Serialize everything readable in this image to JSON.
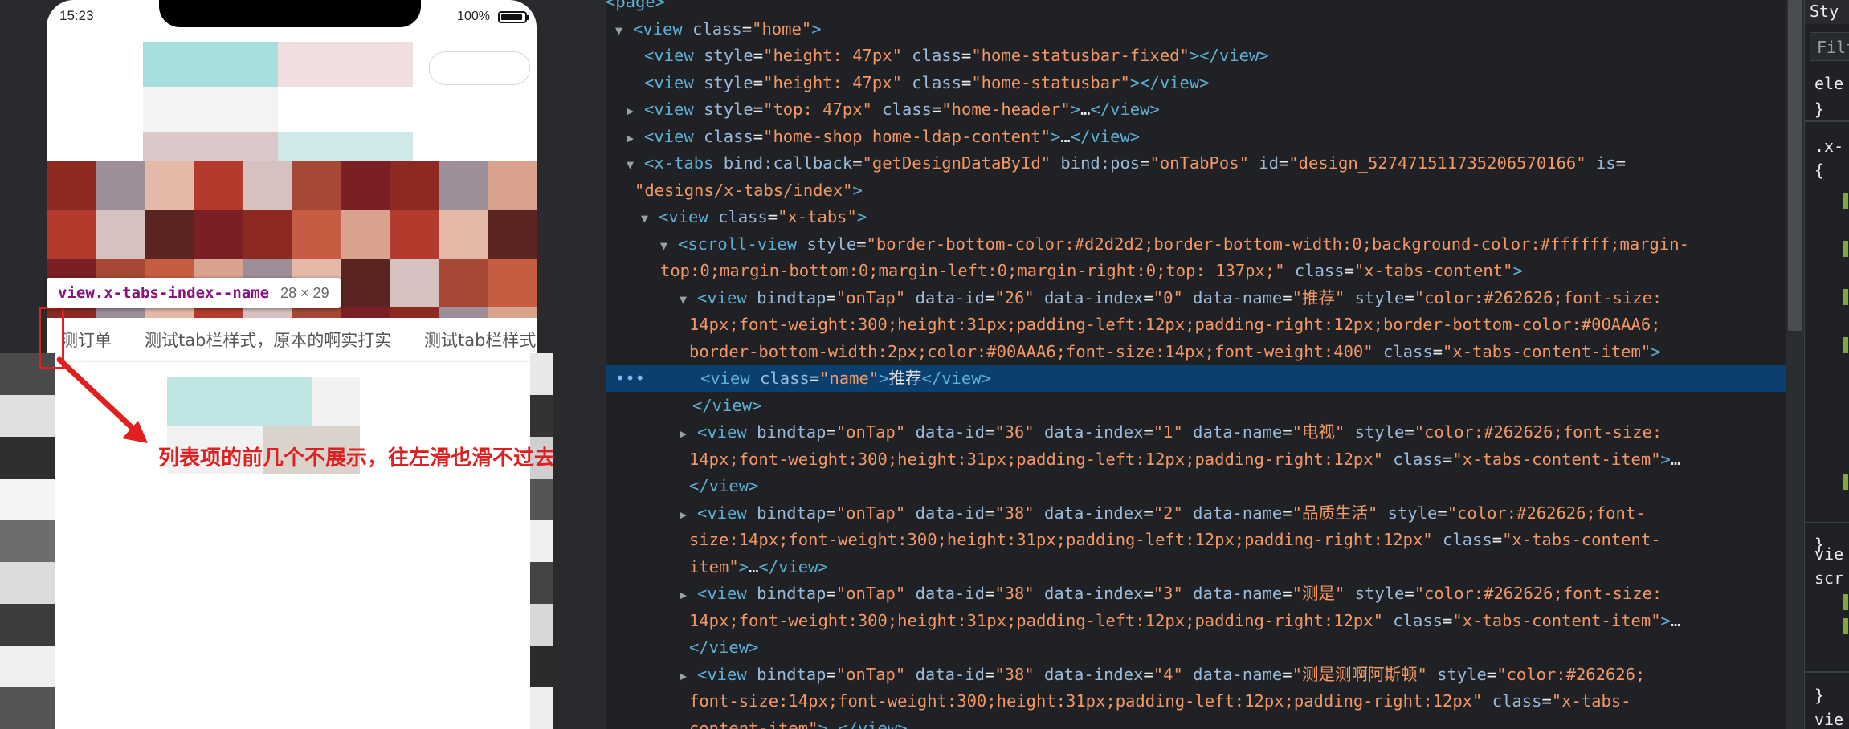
{
  "phone": {
    "status_time": "15:23",
    "battery_percent": "100%",
    "battery_icon": "battery-full-icon"
  },
  "inspector_tooltip": {
    "selector": "view.x-tabs-index--name",
    "size": "28 × 29"
  },
  "tabs": [
    "测订单",
    "测试tab栏样式，原本的啊实打实",
    "测试tab栏样式"
  ],
  "annotation": {
    "text": "列表项的前几个不展示，往左滑也滑不过去",
    "color": "#e02020"
  },
  "devtools": {
    "lines": [
      {
        "html": "<span class='tag'>&lt;page&gt;</span>"
      },
      {
        "tri": "▼",
        "html": "<span class='tag'>&lt;view</span> <span class='attr'>class</span>=<span class='val'>\"home\"</span><span class='tag'>&gt;</span>"
      },
      {
        "html": "<span class='tag'>&lt;view</span> <span class='attr'>style</span>=<span class='val'>\"height: 47px\"</span> <span class='attr'>class</span>=<span class='val'>\"home-statusbar-fixed\"</span><span class='tag'>&gt;&lt;/view&gt;</span>"
      },
      {
        "html": "<span class='tag'>&lt;view</span> <span class='attr'>style</span>=<span class='val'>\"height: 47px\"</span> <span class='attr'>class</span>=<span class='val'>\"home-statusbar\"</span><span class='tag'>&gt;&lt;/view&gt;</span>"
      },
      {
        "tri": "▶",
        "html": "<span class='tag'>&lt;view</span> <span class='attr'>style</span>=<span class='val'>\"top: 47px\"</span> <span class='attr'>class</span>=<span class='val'>\"home-header\"</span><span class='tag'>&gt;</span>…<span class='tag'>&lt;/view&gt;</span>"
      },
      {
        "tri": "▶",
        "html": "<span class='tag'>&lt;view</span> <span class='attr'>class</span>=<span class='val'>\"home-shop home-ldap-content\"</span><span class='tag'>&gt;</span>…<span class='tag'>&lt;/view&gt;</span>"
      },
      {
        "tri": "▼",
        "html": "<span class='tag'>&lt;x-tabs</span> <span class='attr'>bind:callback</span>=<span class='val'>\"getDesignDataById\"</span> <span class='attr'>bind:pos</span>=<span class='val'>\"onTabPos\"</span> <span class='attr'>id</span>=<span class='val'>\"design_527471511735206570166\"</span> <span class='attr'>is</span>="
      },
      {
        "html": "<span class='val'>\"designs/x-tabs/index\"</span><span class='tag'>&gt;</span>"
      },
      {
        "tri": "▼",
        "html": "<span class='tag'>&lt;view</span> <span class='attr'>class</span>=<span class='val'>\"x-tabs\"</span><span class='tag'>&gt;</span>"
      },
      {
        "tri": "▼",
        "html": "<span class='tag'>&lt;scroll-view</span> <span class='attr'>style</span>=<span class='val'>\"border-bottom-color:#d2d2d2;border-bottom-width:0;background-color:#ffffff;margin-</span>"
      },
      {
        "html": "<span class='val'>top:0;margin-bottom:0;margin-left:0;margin-right:0;top: 137px;\"</span> <span class='attr'>class</span>=<span class='val'>\"x-tabs-content\"</span><span class='tag'>&gt;</span>"
      },
      {
        "tri": "▼",
        "html": "<span class='tag'>&lt;view</span> <span class='attr'>bindtap</span>=<span class='val'>\"onTap\"</span> <span class='attr'>data-id</span>=<span class='val'>\"26\"</span> <span class='attr'>data-index</span>=<span class='val'>\"0\"</span> <span class='attr'>data-name</span>=<span class='val'>\"推荐\"</span> <span class='attr'>style</span>=<span class='val'>\"color:#262626;font-size:</span>"
      },
      {
        "html": "<span class='val'>14px;font-weight:300;height:31px;padding-left:12px;padding-right:12px;border-bottom-color:#00AAA6;</span>"
      },
      {
        "html": "<span class='val'>border-bottom-width:2px;color:#00AAA6;font-size:14px;font-weight:400\"</span> <span class='attr'>class</span>=<span class='val'>\"x-tabs-content-item\"</span><span class='tag'>&gt;</span>"
      },
      {
        "selected": true,
        "html": "<span class='tag'>&lt;view</span> <span class='attr'>class</span>=<span class='val'>\"name\"</span><span class='tag'>&gt;</span><span class='txt'>推荐</span><span class='tag'>&lt;/view&gt;</span>"
      },
      {
        "html": "<span class='tag'>&lt;/view&gt;</span>"
      },
      {
        "tri": "▶",
        "html": "<span class='tag'>&lt;view</span> <span class='attr'>bindtap</span>=<span class='val'>\"onTap\"</span> <span class='attr'>data-id</span>=<span class='val'>\"36\"</span> <span class='attr'>data-index</span>=<span class='val'>\"1\"</span> <span class='attr'>data-name</span>=<span class='val'>\"电视\"</span> <span class='attr'>style</span>=<span class='val'>\"color:#262626;font-size:</span>"
      },
      {
        "html": "<span class='val'>14px;font-weight:300;height:31px;padding-left:12px;padding-right:12px\"</span> <span class='attr'>class</span>=<span class='val'>\"x-tabs-content-item\"</span><span class='tag'>&gt;</span>…"
      },
      {
        "html": "<span class='tag'>&lt;/view&gt;</span>"
      },
      {
        "tri": "▶",
        "html": "<span class='tag'>&lt;view</span> <span class='attr'>bindtap</span>=<span class='val'>\"onTap\"</span> <span class='attr'>data-id</span>=<span class='val'>\"38\"</span> <span class='attr'>data-index</span>=<span class='val'>\"2\"</span> <span class='attr'>data-name</span>=<span class='val'>\"品质生活\"</span> <span class='attr'>style</span>=<span class='val'>\"color:#262626;font-</span>"
      },
      {
        "html": "<span class='val'>size:14px;font-weight:300;height:31px;padding-left:12px;padding-right:12px\"</span> <span class='attr'>class</span>=<span class='val'>\"x-tabs-content-</span>"
      },
      {
        "html": "<span class='val'>item\"</span><span class='tag'>&gt;</span>…<span class='tag'>&lt;/view&gt;</span>"
      },
      {
        "tri": "▶",
        "html": "<span class='tag'>&lt;view</span> <span class='attr'>bindtap</span>=<span class='val'>\"onTap\"</span> <span class='attr'>data-id</span>=<span class='val'>\"38\"</span> <span class='attr'>data-index</span>=<span class='val'>\"3\"</span> <span class='attr'>data-name</span>=<span class='val'>\"测是\"</span> <span class='attr'>style</span>=<span class='val'>\"color:#262626;font-size:</span>"
      },
      {
        "html": "<span class='val'>14px;font-weight:300;height:31px;padding-left:12px;padding-right:12px\"</span> <span class='attr'>class</span>=<span class='val'>\"x-tabs-content-item\"</span><span class='tag'>&gt;</span>…"
      },
      {
        "html": "<span class='tag'>&lt;/view&gt;</span>"
      },
      {
        "tri": "▶",
        "html": "<span class='tag'>&lt;view</span> <span class='attr'>bindtap</span>=<span class='val'>\"onTap\"</span> <span class='attr'>data-id</span>=<span class='val'>\"38\"</span> <span class='attr'>data-index</span>=<span class='val'>\"4\"</span> <span class='attr'>data-name</span>=<span class='val'>\"测是测啊阿斯顿\"</span> <span class='attr'>style</span>=<span class='val'>\"color:#262626;</span>"
      },
      {
        "html": "<span class='val'>font-size:14px;font-weight:300;height:31px;padding-left:12px;padding-right:12px\"</span> <span class='attr'>class</span>=<span class='val'>\"x-tabs-</span>"
      },
      {
        "html": "<span class='val'>content-item\"</span><span class='tag'>&gt;</span>…<span class='tag'>&lt;/view&gt;</span>"
      }
    ],
    "selected_marker": "•••"
  },
  "styles_pane": {
    "tab_label": "Sty",
    "filter_placeholder": "Filt",
    "rows": [
      "ele",
      "}",
      ".x-",
      "{",
      "}",
      "vie",
      "scr",
      "}",
      "vie"
    ]
  }
}
